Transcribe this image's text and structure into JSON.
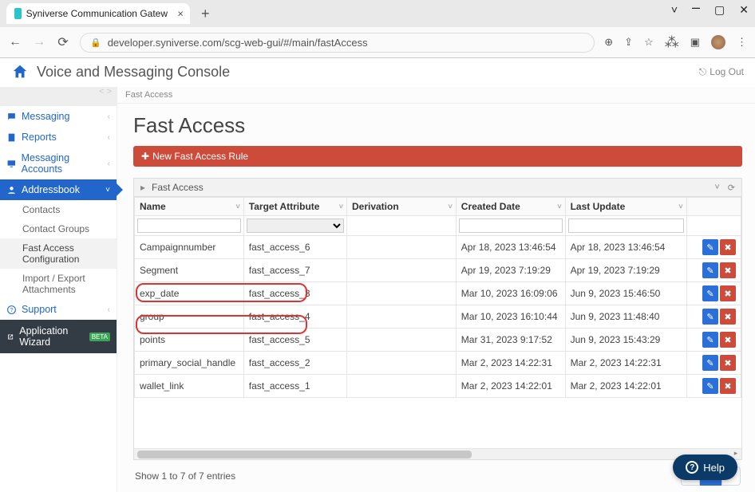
{
  "browser": {
    "tab_title": "Syniverse Communication Gatew",
    "url": "developer.syniverse.com/scg-web-gui/#/main/fastAccess"
  },
  "header": {
    "title": "Voice and Messaging Console",
    "logout": "Log Out"
  },
  "sidebar": {
    "items": [
      {
        "icon": "chat",
        "label": "Messaging"
      },
      {
        "icon": "doc",
        "label": "Reports"
      },
      {
        "icon": "monitor",
        "label": "Messaging Accounts"
      },
      {
        "icon": "user",
        "label": "Addressbook",
        "active": true
      },
      {
        "icon": "help",
        "label": "Support"
      }
    ],
    "addressbook_subs": [
      {
        "label": "Contacts"
      },
      {
        "label": "Contact Groups"
      },
      {
        "label": "Fast Access Configuration",
        "selected": true
      },
      {
        "label": "Import / Export Attachments"
      }
    ],
    "wizard": {
      "label": "Application Wizard",
      "badge": "BETA"
    }
  },
  "breadcrumb": "Fast Access",
  "page": {
    "title": "Fast Access",
    "new_button": "New Fast Access Rule"
  },
  "grid": {
    "title": "Fast Access",
    "columns": [
      "Name",
      "Target Attribute",
      "Derivation",
      "Created Date",
      "Last Update",
      ""
    ],
    "rows": [
      {
        "name": "Campaignnumber",
        "target": "fast_access_6",
        "derivation": "",
        "created": "Apr 18, 2023 13:46:54",
        "updated": "Apr 18, 2023 13:46:54"
      },
      {
        "name": "Segment",
        "target": "fast_access_7",
        "derivation": "",
        "created": "Apr 19, 2023 7:19:29",
        "updated": "Apr 19, 2023 7:19:29"
      },
      {
        "name": "exp_date",
        "target": "fast_access_3",
        "derivation": "",
        "created": "Mar 10, 2023 16:09:06",
        "updated": "Jun 9, 2023 15:46:50"
      },
      {
        "name": "group",
        "target": "fast_access_4",
        "derivation": "",
        "created": "Mar 10, 2023 16:10:44",
        "updated": "Jun 9, 2023 11:48:40"
      },
      {
        "name": "points",
        "target": "fast_access_5",
        "derivation": "",
        "created": "Mar 31, 2023 9:17:52",
        "updated": "Jun 9, 2023 15:43:29"
      },
      {
        "name": "primary_social_handle",
        "target": "fast_access_2",
        "derivation": "",
        "created": "Mar 2, 2023 14:22:31",
        "updated": "Mar 2, 2023 14:22:31"
      },
      {
        "name": "wallet_link",
        "target": "fast_access_1",
        "derivation": "",
        "created": "Mar 2, 2023 14:22:01",
        "updated": "Mar 2, 2023 14:22:01"
      }
    ],
    "footer_info": "Show 1 to 7 of 7 entries",
    "page_current": "1"
  },
  "help": {
    "label": "Help"
  }
}
